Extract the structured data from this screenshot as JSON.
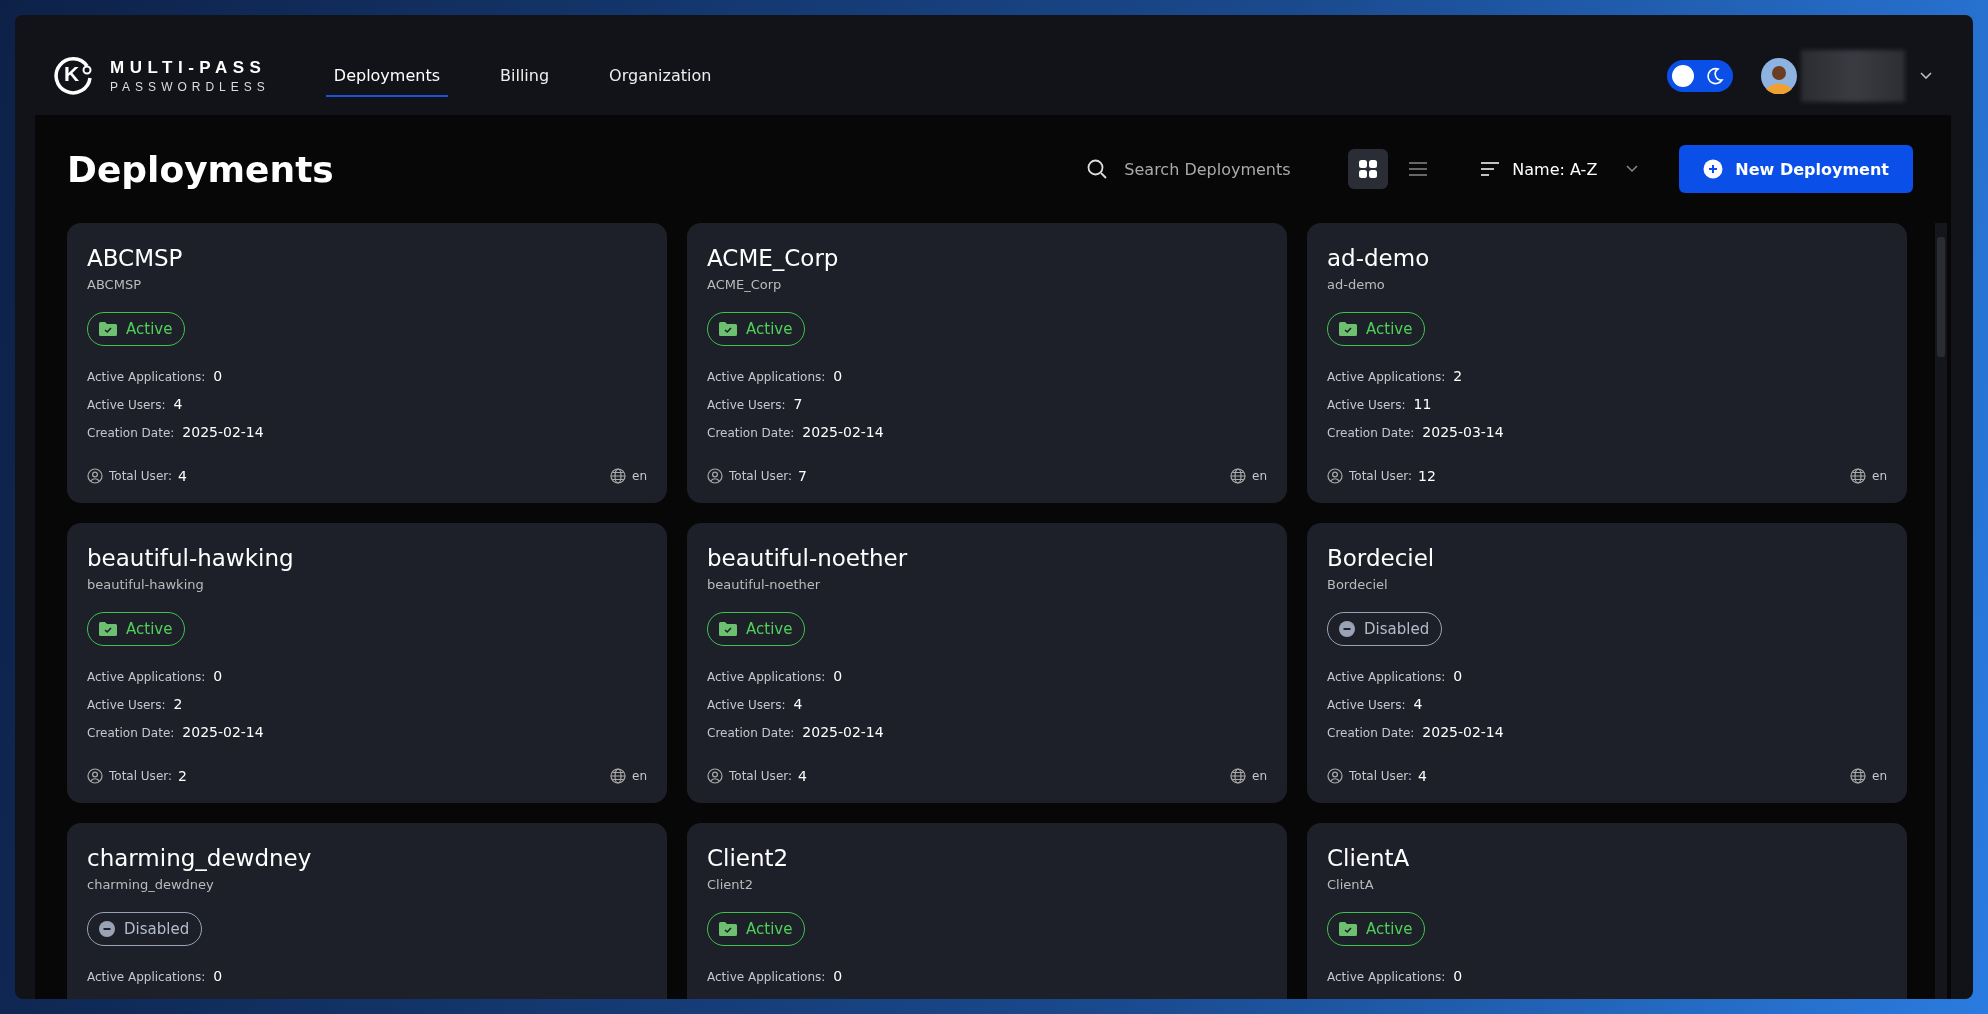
{
  "brand": {
    "name": "MULTI-PASS",
    "tagline": "PASSWORDLESS",
    "mark": "K"
  },
  "nav": [
    {
      "label": "Deployments",
      "selected": true
    },
    {
      "label": "Billing",
      "selected": false
    },
    {
      "label": "Organization",
      "selected": false
    }
  ],
  "theme_toggle": {
    "dark_mode": true
  },
  "page_title": "Deployments",
  "search": {
    "placeholder": "Search Deployments"
  },
  "view_modes": [
    {
      "kind": "grid",
      "selected": true
    },
    {
      "kind": "list",
      "selected": false
    }
  ],
  "sort": {
    "label": "Name: A-Z"
  },
  "new_button": "New Deployment",
  "deployments": [
    {
      "name": "ABCMSP",
      "slug": "ABCMSP",
      "status": {
        "kind": "active",
        "label": "Active"
      },
      "stats": [
        {
          "label": "Active Applications:",
          "value": "0"
        },
        {
          "label": "Active Users:",
          "value": "4"
        },
        {
          "label": "Creation Date:",
          "value": "2025-02-14"
        }
      ],
      "total": {
        "label": "Total User:",
        "value": "4"
      },
      "lang": "en"
    },
    {
      "name": "ACME_Corp",
      "slug": "ACME_Corp",
      "status": {
        "kind": "active",
        "label": "Active"
      },
      "stats": [
        {
          "label": "Active Applications:",
          "value": "0"
        },
        {
          "label": "Active Users:",
          "value": "7"
        },
        {
          "label": "Creation Date:",
          "value": "2025-02-14"
        }
      ],
      "total": {
        "label": "Total User:",
        "value": "7"
      },
      "lang": "en"
    },
    {
      "name": "ad-demo",
      "slug": "ad-demo",
      "status": {
        "kind": "active",
        "label": "Active"
      },
      "stats": [
        {
          "label": "Active Applications:",
          "value": "2"
        },
        {
          "label": "Active Users:",
          "value": "11"
        },
        {
          "label": "Creation Date:",
          "value": "2025-03-14"
        }
      ],
      "total": {
        "label": "Total User:",
        "value": "12"
      },
      "lang": "en"
    },
    {
      "name": "beautiful-hawking",
      "slug": "beautiful-hawking",
      "status": {
        "kind": "active",
        "label": "Active"
      },
      "stats": [
        {
          "label": "Active Applications:",
          "value": "0"
        },
        {
          "label": "Active Users:",
          "value": "2"
        },
        {
          "label": "Creation Date:",
          "value": "2025-02-14"
        }
      ],
      "total": {
        "label": "Total User:",
        "value": "2"
      },
      "lang": "en"
    },
    {
      "name": "beautiful-noether",
      "slug": "beautiful-noether",
      "status": {
        "kind": "active",
        "label": "Active"
      },
      "stats": [
        {
          "label": "Active Applications:",
          "value": "0"
        },
        {
          "label": "Active Users:",
          "value": "4"
        },
        {
          "label": "Creation Date:",
          "value": "2025-02-14"
        }
      ],
      "total": {
        "label": "Total User:",
        "value": "4"
      },
      "lang": "en"
    },
    {
      "name": "Bordeciel",
      "slug": "Bordeciel",
      "status": {
        "kind": "disabled",
        "label": "Disabled"
      },
      "stats": [
        {
          "label": "Active Applications:",
          "value": "0"
        },
        {
          "label": "Active Users:",
          "value": "4"
        },
        {
          "label": "Creation Date:",
          "value": "2025-02-14"
        }
      ],
      "total": {
        "label": "Total User:",
        "value": "4"
      },
      "lang": "en"
    },
    {
      "name": "charming_dewdney",
      "slug": "charming_dewdney",
      "status": {
        "kind": "disabled",
        "label": "Disabled"
      },
      "stats": [
        {
          "label": "Active Applications:",
          "value": "0"
        }
      ]
    },
    {
      "name": "Client2",
      "slug": "Client2",
      "status": {
        "kind": "active",
        "label": "Active"
      },
      "stats": [
        {
          "label": "Active Applications:",
          "value": "0"
        }
      ]
    },
    {
      "name": "ClientA",
      "slug": "ClientA",
      "status": {
        "kind": "active",
        "label": "Active"
      },
      "stats": [
        {
          "label": "Active Applications:",
          "value": "0"
        }
      ]
    }
  ]
}
